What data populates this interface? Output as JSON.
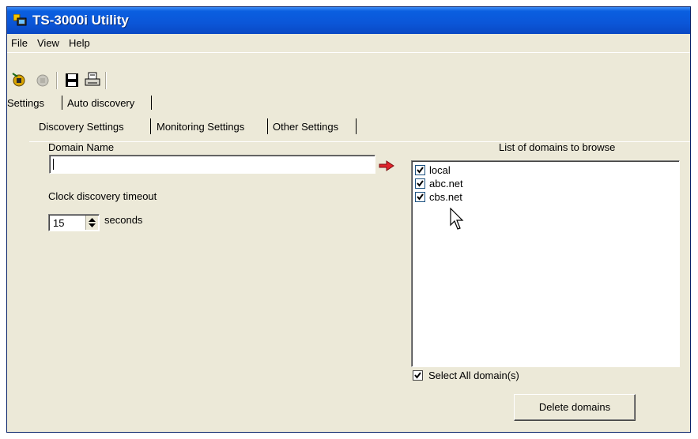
{
  "window": {
    "title": "TS-3000i Utility"
  },
  "menu": [
    "File",
    "View",
    "Help"
  ],
  "toolbar": [
    {
      "name": "discover-icon",
      "icon": "discover-icon"
    },
    {
      "name": "stop-icon",
      "icon": "stop-icon"
    },
    {
      "name": "save-icon",
      "icon": "floppy-disk-icon"
    },
    {
      "name": "print-icon",
      "icon": "printer-icon"
    }
  ],
  "tabs": {
    "top": [
      "Settings",
      "Auto discovery"
    ],
    "sub": [
      "Discovery Settings",
      "Monitoring Settings",
      "Other Settings"
    ]
  },
  "discovery": {
    "domain_label": "Domain Name",
    "domain_value": "",
    "timeout_label": "Clock discovery timeout",
    "timeout_value": "15",
    "timeout_unit": "seconds"
  },
  "domains": {
    "title": "List of domains to browse",
    "items": [
      {
        "label": "local",
        "checked": true
      },
      {
        "label": "abc.net",
        "checked": true
      },
      {
        "label": "cbs.net",
        "checked": true
      }
    ],
    "select_all_label": "Select All domain(s)",
    "select_all_checked": true,
    "delete_button": "Delete domains"
  },
  "colors": {
    "titlebar": "#0a5fe0",
    "window_bg": "#ece9d8",
    "arrow": "#e0242b"
  }
}
